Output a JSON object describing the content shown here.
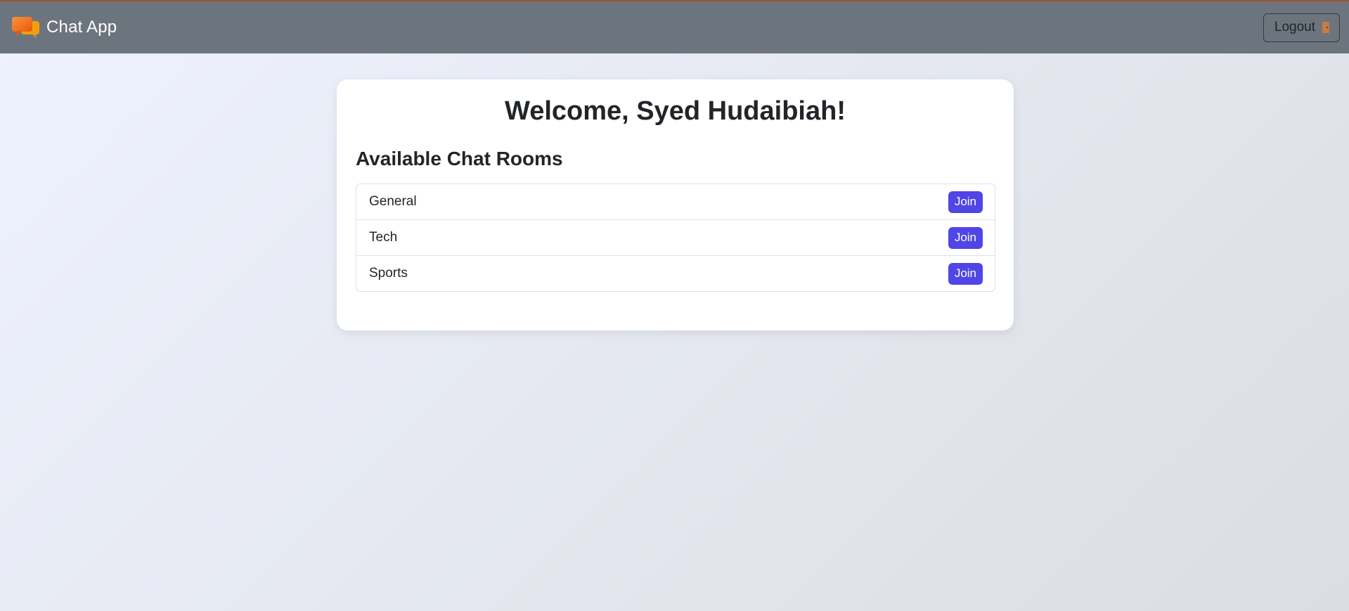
{
  "header": {
    "brand_icon": "chat-bubbles-icon",
    "brand_name": "Chat App",
    "logout_label": "Logout",
    "logout_icon": "door-icon",
    "background_color": "#6c757d",
    "accent_color": "#f97316"
  },
  "main": {
    "welcome": "Welcome, Syed Hudaibiah!",
    "rooms_heading": "Available Chat Rooms",
    "rooms": [
      {
        "name": "General",
        "action": "Join"
      },
      {
        "name": "Tech",
        "action": "Join"
      },
      {
        "name": "Sports",
        "action": "Join"
      }
    ],
    "join_button_color": "#4f46e5"
  }
}
